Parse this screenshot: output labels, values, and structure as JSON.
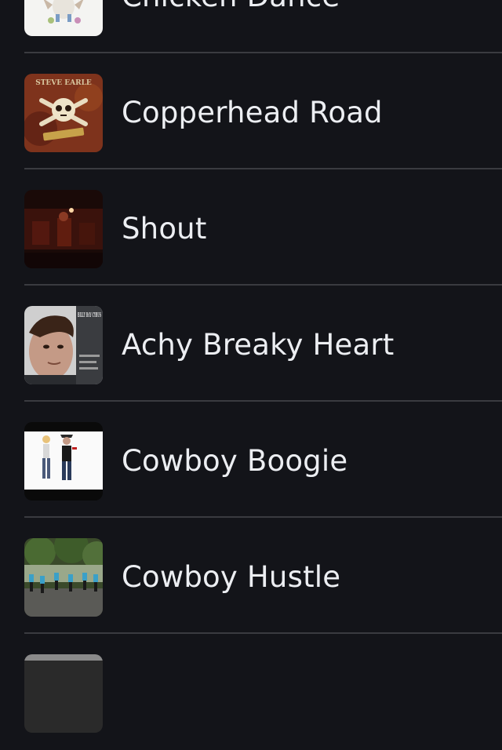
{
  "songs": [
    {
      "title": "Chicken Dance",
      "thumbnail_icon": "chicken-dance-artwork-icon"
    },
    {
      "title": "Copperhead Road",
      "thumbnail_icon": "copperhead-road-artwork-icon",
      "artwork_text": "STEVE EARLE"
    },
    {
      "title": "Shout",
      "thumbnail_icon": "shout-artwork-icon"
    },
    {
      "title": "Achy Breaky Heart",
      "thumbnail_icon": "achy-breaky-heart-artwork-icon",
      "artwork_text": "BILLY RAY CYRUS"
    },
    {
      "title": "Cowboy Boogie",
      "thumbnail_icon": "cowboy-boogie-artwork-icon"
    },
    {
      "title": "Cowboy Hustle",
      "thumbnail_icon": "cowboy-hustle-artwork-icon"
    },
    {
      "title": "",
      "thumbnail_icon": "next-song-artwork-icon"
    }
  ],
  "colors": {
    "background": "#131419",
    "title_text": "#eceef2",
    "divider": "#3a3b40"
  }
}
